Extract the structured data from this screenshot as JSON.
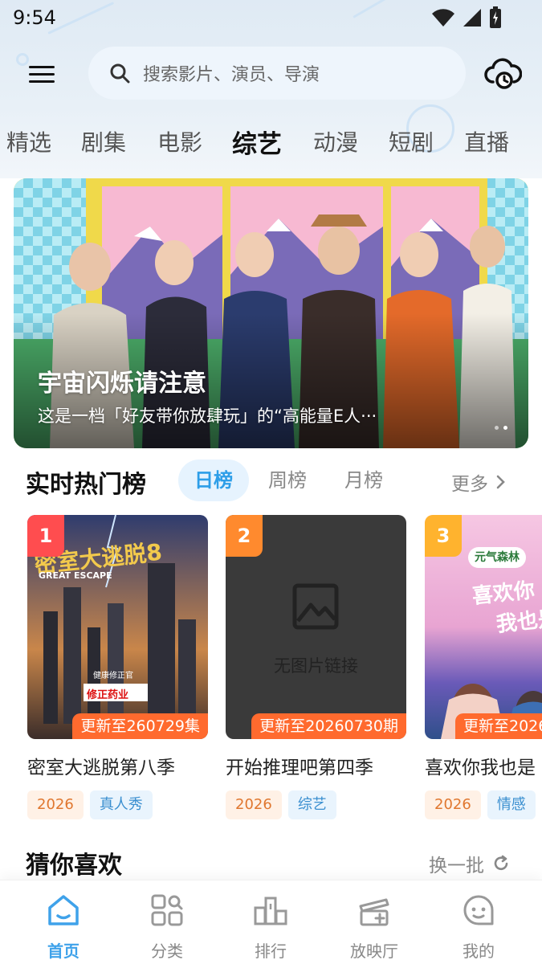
{
  "status_bar": {
    "time": "9:54"
  },
  "search": {
    "placeholder": "搜索影片、演员、导演"
  },
  "category_tabs": [
    {
      "label": "精选"
    },
    {
      "label": "剧集"
    },
    {
      "label": "电影"
    },
    {
      "label": "综艺",
      "active": true
    },
    {
      "label": "动漫"
    },
    {
      "label": "短剧"
    },
    {
      "label": "直播"
    }
  ],
  "banner": {
    "title": "宇宙闪烁请注意",
    "description": "这是一档「好友带你放肆玩」的“高能量E人···",
    "page_count": 2,
    "current_page": 2
  },
  "hot_chart": {
    "title": "实时热门榜",
    "tabs": [
      {
        "label": "日榜",
        "active": true
      },
      {
        "label": "周榜"
      },
      {
        "label": "月榜"
      }
    ],
    "more_label": "更多",
    "items": [
      {
        "rank": "1",
        "name": "密室大逃脱第八季",
        "update": "更新至260729集",
        "year": "2026",
        "genre": "真人秀",
        "poster_title": "GREAT ESCAPE",
        "sponsor": "修正药业",
        "sponsor_caption": "健康修正官"
      },
      {
        "rank": "2",
        "name": "开始推理吧第四季",
        "update": "更新至20260730期",
        "year": "2026",
        "genre": "综艺",
        "placeholder": "无图片链接"
      },
      {
        "rank": "3",
        "name": "喜欢你我也是",
        "update": "更新至2026",
        "year": "2026",
        "genre": "情感",
        "poster_badge": "元气森林"
      }
    ]
  },
  "guess": {
    "title": "猜你喜欢",
    "refresh_label": "换一批"
  },
  "bottom_nav": [
    {
      "label": "首页",
      "icon": "home-icon",
      "active": true
    },
    {
      "label": "分类",
      "icon": "category-icon"
    },
    {
      "label": "排行",
      "icon": "ranking-icon"
    },
    {
      "label": "放映厅",
      "icon": "theater-icon"
    },
    {
      "label": "我的",
      "icon": "profile-icon"
    }
  ],
  "colors": {
    "accent": "#3fa2ea",
    "rank_1": "#ff4d4f",
    "rank_2": "#ff8a2e",
    "rank_3": "#ffb32e",
    "update_tag": "#ff6a2e"
  }
}
